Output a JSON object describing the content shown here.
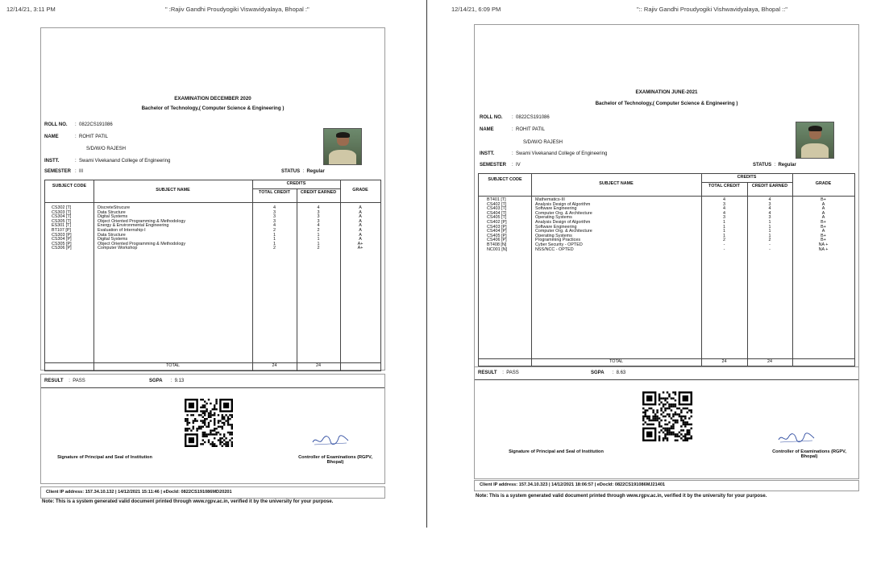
{
  "left": {
    "timestamp": "12/14/21, 3:11 PM",
    "page_title": "\" :Rajiv Gandhi Proudyogiki Viswavidyalaya, Bhopal :\"",
    "exam_title": "EXAMINATION DECEMBER 2020",
    "program": "Bachelor of Technology,( Computer Science & Engineering )",
    "labels": {
      "roll": "ROLL NO.",
      "name": "NAME",
      "instt": "INSTT.",
      "semester": "SEMESTER",
      "status": "STATUS",
      "result": "RESULT",
      "sgpa": "SGPA"
    },
    "roll_no": "0822CS191086",
    "student_name": "ROHIT PATIL",
    "relation": "S/D/W/O RAJESH",
    "institute": "Swami Vivekanand College of Engineering",
    "semester": "III",
    "status": "Regular",
    "table_headers": {
      "code": "SUBJECT CODE",
      "name": "SUBJECT NAME",
      "credits": "CREDITS",
      "total_credit": "TOTAL CREDIT",
      "credit_earned": "CREDIT EARNED",
      "grade": "GRADE"
    },
    "rows": [
      {
        "code": "CS302 [T]",
        "name": "DiscreteStrucure",
        "total": "4",
        "earned": "4",
        "grade": "A"
      },
      {
        "code": "CS303 [T]",
        "name": "Data Structure",
        "total": "3",
        "earned": "3",
        "grade": "A"
      },
      {
        "code": "CS304 [T]",
        "name": "Digital Systems",
        "total": "3",
        "earned": "3",
        "grade": "A"
      },
      {
        "code": "CS305 [T]",
        "name": "Object Oriented Programming & Methodology",
        "total": "3",
        "earned": "3",
        "grade": "A"
      },
      {
        "code": "ES301 [T]",
        "name": "Energy & Environmental Engineering",
        "total": "4",
        "earned": "4",
        "grade": "A"
      },
      {
        "code": "BT107 [P]",
        "name": "Evaluation of Internship-I",
        "total": "2",
        "earned": "2",
        "grade": "A"
      },
      {
        "code": "CS303 [P]",
        "name": "Data Structure",
        "total": "1",
        "earned": "1",
        "grade": "A"
      },
      {
        "code": "CS304 [P]",
        "name": "Digital Systems",
        "total": "1",
        "earned": "1",
        "grade": "A"
      },
      {
        "code": "CS305 [P]",
        "name": "Object Oriented Programming & Methodology",
        "total": "1",
        "earned": "1",
        "grade": "A+"
      },
      {
        "code": "CS306 [P]",
        "name": "Computer Workshop",
        "total": "2",
        "earned": "2",
        "grade": "A+"
      }
    ],
    "total_label": "TOTAL",
    "total_credit": "24",
    "total_earned": "24",
    "result": "PASS",
    "sgpa": "9.13",
    "sig_left": "Signature of Principal and Seal of Institution",
    "sig_right": "Controller of Examinations (RGPV, Bhopal)",
    "footer": "Client IP address: 157.34.10.132   |   14/12/2021 15:11:46   |   eDocId: 0822CS191086MD20201",
    "note": "Note: This is a system generated valid document printed through www.rgpv.ac.in, verified it by the university for your purpose."
  },
  "right": {
    "timestamp": "12/14/21, 6:09 PM",
    "page_title": "\":: Rajiv Gandhi Proudyogiki Vishwavidyalaya, Bhopal ::\"",
    "exam_title": "EXAMINATION JUNE-2021",
    "program": "Bachelor of Technology,( Computer Science & Engineering )",
    "labels": {
      "roll": "ROLL NO.",
      "name": "NAME",
      "instt": "INSTT.",
      "semester": "SEMESTER",
      "status": "STATUS",
      "result": "RESULT",
      "sgpa": "SGPA"
    },
    "roll_no": "0822CS191086",
    "student_name": "ROHIT PATIL",
    "relation": "S/D/W/O RAJESH",
    "institute": "Swami Vivekanand College of Engineering",
    "semester": "IV",
    "status": "Regular",
    "table_headers": {
      "code": "SUBJECT CODE",
      "name": "SUBJECT NAME",
      "credits": "CREDITS",
      "total_credit": "TOTAL CREDIT",
      "credit_earned": "CREDIT EARNED",
      "grade": "GRADE"
    },
    "rows": [
      {
        "code": "BT401 [T]",
        "name": "Mathematics-III",
        "total": "4",
        "earned": "4",
        "grade": "B+"
      },
      {
        "code": "CS402 [T]",
        "name": "Analysis Design of Algorithm",
        "total": "3",
        "earned": "3",
        "grade": "A"
      },
      {
        "code": "CS403 [T]",
        "name": "Software Engineering",
        "total": "4",
        "earned": "4",
        "grade": "A"
      },
      {
        "code": "CS404 [T]",
        "name": "Computer Org. & Architecture",
        "total": "4",
        "earned": "4",
        "grade": "A"
      },
      {
        "code": "CS405 [T]",
        "name": "Operating Systems",
        "total": "3",
        "earned": "3",
        "grade": "A"
      },
      {
        "code": "CS402 [P]",
        "name": "Analysis Design of Algorithm",
        "total": "1",
        "earned": "1",
        "grade": "B+"
      },
      {
        "code": "CS403 [P]",
        "name": "Software Engineering",
        "total": "1",
        "earned": "1",
        "grade": "B+"
      },
      {
        "code": "CS404 [P]",
        "name": "Computer Org. & Architecture",
        "total": "1",
        "earned": "1",
        "grade": "A"
      },
      {
        "code": "CS405 [P]",
        "name": "Operating Systems",
        "total": "1",
        "earned": "1",
        "grade": "B+"
      },
      {
        "code": "CS406 [P]",
        "name": "Programming Practices",
        "total": "2",
        "earned": "2",
        "grade": "B+"
      },
      {
        "code": "BT408 [N]",
        "name": "Cyber Security - OPTED",
        "total": "-",
        "earned": "-",
        "grade": "NA +"
      },
      {
        "code": "NC001 [N]",
        "name": "NSS/NCC - OPTED",
        "total": "-",
        "earned": "-",
        "grade": "NA +"
      }
    ],
    "total_label": "TOTAL",
    "total_credit": "24",
    "total_earned": "24",
    "result": "PASS",
    "sgpa": "8.63",
    "sig_left": "Signature of Principal and Seal of Institution",
    "sig_right": "Controller of Examinations (RGPV, Bhopal)",
    "footer": "Client IP address: 157.34.10.323   |   14/12/2021 18:06:57   |   eDocId: 0822CS191086MJ21401",
    "note": "Note: This is a system generated valid document printed through www.rgpv.ac.in, verified it by the university for your purpose."
  }
}
